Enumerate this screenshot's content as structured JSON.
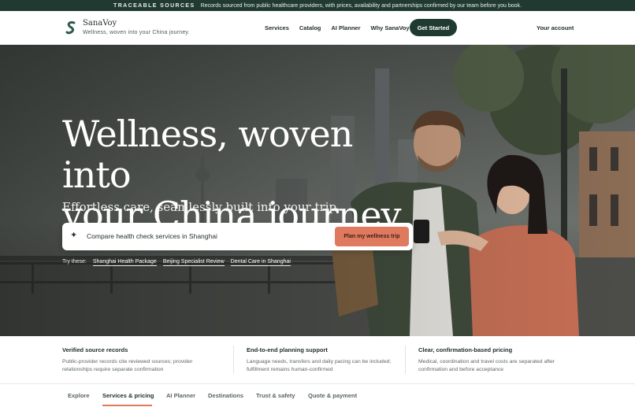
{
  "announcement": {
    "tag": "TRACEABLE SOURCES",
    "text": "Records sourced from public healthcare providers, with prices, availability and partnerships confirmed by our team before you book."
  },
  "header": {
    "brand": "SanaVoy",
    "tagline": "Wellness, woven into your China journey.",
    "nav": [
      "Services",
      "Catalog",
      "AI Planner",
      "Why SanaVoy"
    ],
    "cta": "Get Started",
    "account": "Your account"
  },
  "hero": {
    "title_line1": "Wellness, woven into",
    "title_line2": "your China journey.",
    "subtitle": "Effortless care, seamlessly built into your trip.",
    "search": {
      "value": "Compare health check services in Shanghai",
      "button": "Plan my wellness trip"
    },
    "try_label": "Try these:",
    "suggestions": [
      "Shanghai Health Package",
      "Beijing Specialist Review",
      "Dental Care in Shanghai"
    ]
  },
  "features": [
    {
      "title": "Verified source records",
      "text": "Public-provider records cite reviewed sources; provider relationships require separate confirmation"
    },
    {
      "title": "End-to-end planning support",
      "text": "Language needs, transfers and daily pacing can be included; fulfillment remains human-confirmed"
    },
    {
      "title": "Clear, confirmation-based pricing",
      "text": "Medical, coordination and travel costs are separated after confirmation and before acceptance"
    }
  ],
  "tabs": [
    "Explore",
    "Services & pricing",
    "AI Planner",
    "Destinations",
    "Trust & safety",
    "Quote & payment"
  ],
  "active_tab": "Services & pricing",
  "colors": {
    "brand_dark": "#1f3a31",
    "accent": "#e07a5f"
  },
  "icons": {
    "logo": "sanavoy-logo-icon",
    "search": "sparkle-icon"
  }
}
